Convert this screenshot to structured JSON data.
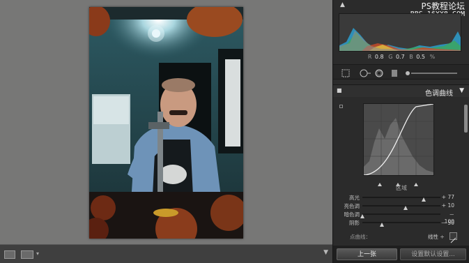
{
  "window": {
    "watermark_line1": "PS教程论坛",
    "watermark_line2": "BBS.16XX8.COM"
  },
  "histogram": {
    "r_label": "R",
    "r_value": "0.8",
    "g_label": "G",
    "g_value": "0.7",
    "b_label": "B",
    "b_value": "0.5",
    "unit": "%"
  },
  "tone_curve": {
    "title": "色调曲线",
    "region_label": "区域",
    "sliders": [
      {
        "label": "高光",
        "value": "+ 77",
        "level": 0.79
      },
      {
        "label": "亮色调",
        "value": "+ 10",
        "level": 0.55
      },
      {
        "label": "暗色调",
        "value": "－ 100",
        "level": 0.0
      },
      {
        "label": "阴影",
        "value": "－ 50",
        "level": 0.25
      }
    ],
    "point_curve_label": "点曲线：",
    "point_curve_value": "线性 ÷"
  },
  "buttons": {
    "previous": "上一张",
    "reset": "设置默认设置..."
  },
  "icons": {
    "crop": "crop-icon",
    "spot_removal": "spot-removal-icon",
    "red_eye": "red-eye-icon",
    "graduated_filter": "graduated-filter-icon",
    "brush": "adjustment-brush-icon"
  },
  "colors": {
    "panel_bg": "#2b2b2b",
    "canvas_bg": "#777776"
  }
}
